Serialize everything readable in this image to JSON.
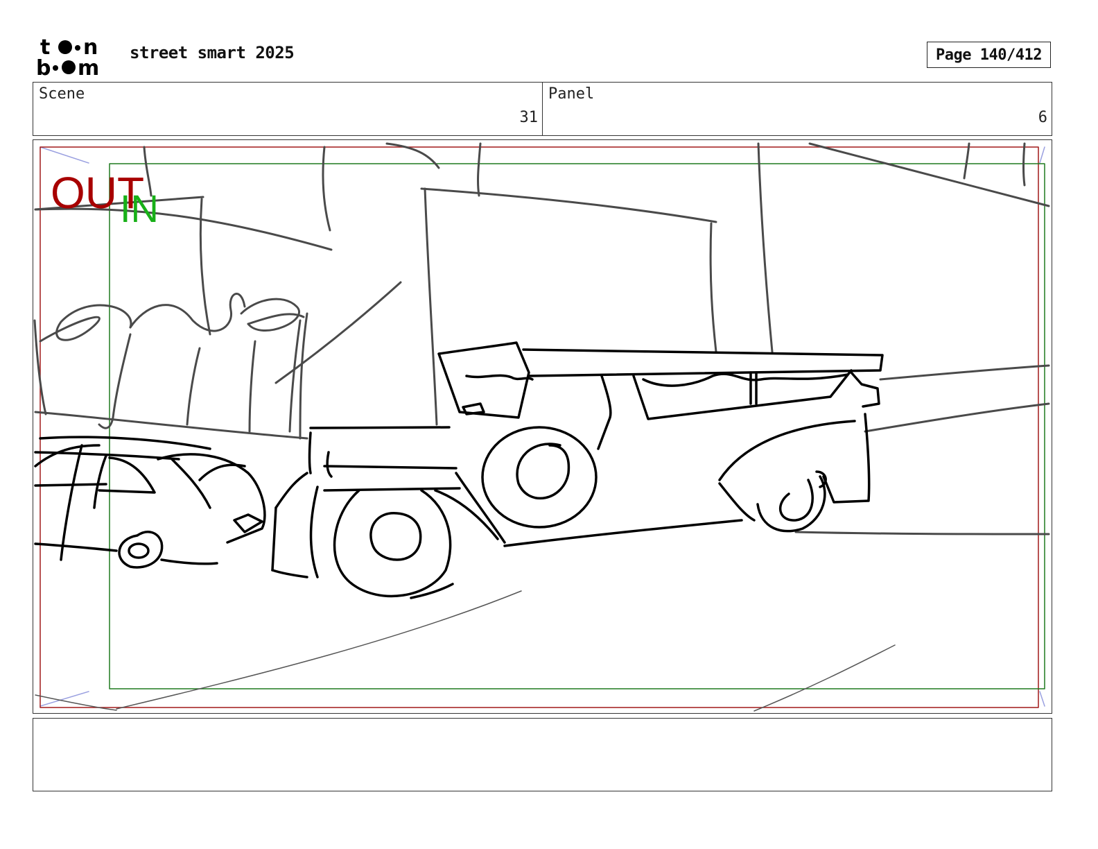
{
  "header": {
    "logo_text": "toon boom",
    "project_title": "street smart 2025",
    "page_label": "Page 140/412"
  },
  "info": {
    "scene_label": "Scene",
    "scene_value": "31",
    "panel_label": "Panel",
    "panel_value": "6"
  },
  "panel": {
    "out_label": "OUT",
    "in_label": "IN",
    "colors": {
      "out_frame": "#a01818",
      "in_frame": "#1e7a1e",
      "out_text": "#a80000",
      "in_text": "#18b018",
      "sketch_ink": "#000000",
      "sketch_grey": "#4a4a4a"
    }
  },
  "dialogue": {
    "text": ""
  }
}
